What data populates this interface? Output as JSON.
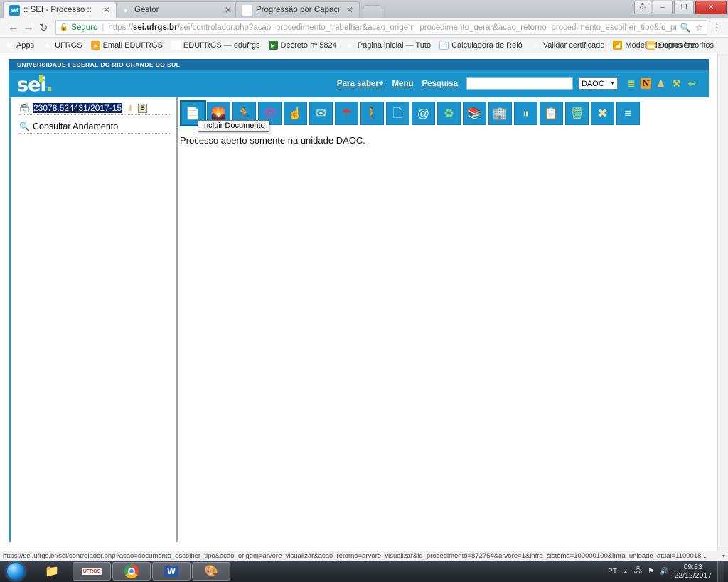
{
  "window": {
    "controls": {
      "user": "user-icon",
      "minimize": "–",
      "maximize": "❐",
      "close": "✕"
    }
  },
  "tabs": [
    {
      "title": ":: SEI - Processo ::",
      "favicon": "sei-favicon",
      "favicon_text": "sei",
      "active": true,
      "close": "✕"
    },
    {
      "title": "Gestor",
      "favicon": "ufrgs-favicon",
      "favicon_text": "♣",
      "active": false,
      "close": "✕"
    },
    {
      "title": "Progressão por Capacita",
      "favicon": "edufrgs-favicon",
      "favicon_text": "⊙",
      "active": false,
      "close": "✕"
    }
  ],
  "toolbar": {
    "back_icon": "back-arrow-icon",
    "forward_icon": "forward-arrow-icon",
    "reload_icon": "reload-icon",
    "secure_label": "Seguro",
    "url_prefix": "https://",
    "url_domain": "sei.ufrgs.br",
    "url_rest": "/sei/controlador.php?acao=procedimento_trabalhar&acao_origem=procedimento_gerar&acao_retorno=procedimento_escolher_tipo&id_proce...",
    "zoom_icon": "magnifier-icon",
    "star_icon": "star-icon",
    "menu_icon": "chrome-menu-icon"
  },
  "bookmarks": {
    "apps_label": "Apps",
    "items": [
      {
        "label": "UFRGS",
        "icon": "ufrgs-icon"
      },
      {
        "label": "Email EDUFRGS",
        "icon": "mail-icon"
      },
      {
        "label": "EDUFRGS — edufrgs",
        "icon": "edufrgs-icon"
      },
      {
        "label": "Decreto nº 5824",
        "icon": "decree-icon"
      },
      {
        "label": "Página inicial — Tuto",
        "icon": "ufrgs-icon"
      },
      {
        "label": "Calculadora de Reló",
        "icon": "document-icon"
      },
      {
        "label": "Validar certificado",
        "icon": "certificate-icon"
      },
      {
        "label": "Modelo de apresent",
        "icon": "presentation-icon"
      }
    ],
    "other_label": "Outros favoritos",
    "other_icon": "folder-icon"
  },
  "sei": {
    "institution": "UNIVERSIDADE FEDERAL DO RIO GRANDE DO SUL",
    "logo": "sei",
    "nav": {
      "saber_mais": "Para saber+",
      "menu": "Menu",
      "pesquisa": "Pesquisa",
      "search_value": "",
      "search_placeholder": "",
      "unit_selected": "DAOC",
      "caret": "▼",
      "icons": [
        {
          "name": "menu-list-icon",
          "glyph": "≣"
        },
        {
          "name": "novidades-icon",
          "glyph": "N"
        },
        {
          "name": "user-icon",
          "glyph": "♟"
        },
        {
          "name": "wrench-icon",
          "glyph": "⚒"
        },
        {
          "name": "logout-icon",
          "glyph": "↩"
        }
      ]
    },
    "tree": {
      "process_number": "23078.524431/2017-15",
      "process_icon": "process-document-icon",
      "badges": [
        {
          "name": "key-icon",
          "glyph": "⚷"
        },
        {
          "name": "b-badge-icon",
          "glyph": "B"
        }
      ],
      "consult_label": "Consultar Andamento",
      "consult_icon": "magnifier-icon"
    },
    "action_buttons": [
      {
        "name": "incluir-documento-button",
        "glyph": "📄",
        "selected": true
      },
      {
        "name": "atualizar-andamento-button",
        "glyph": "🖼"
      },
      {
        "name": "atribuir-processo-button",
        "glyph": "🏃"
      },
      {
        "name": "acompanhamento-especial-button",
        "glyph": "👁"
      },
      {
        "name": "anotacoes-button",
        "glyph": "☝"
      },
      {
        "name": "enviar-correspondencia-eletronica-button",
        "glyph": "✉"
      },
      {
        "name": "ciencia-button",
        "glyph": "☂"
      },
      {
        "name": "consultar-alterar-processo-button",
        "glyph": "🚶"
      },
      {
        "name": "duplicar-processo-button",
        "glyph": "↻"
      },
      {
        "name": "enviar-email-button",
        "glyph": "@"
      },
      {
        "name": "atualizar-andamento2-button",
        "glyph": "♻"
      },
      {
        "name": "gerar-arquivo-button",
        "glyph": "📚"
      },
      {
        "name": "bloquear-processo-button",
        "glyph": "🏢"
      },
      {
        "name": "sobrestar-processo-button",
        "glyph": "⏸"
      },
      {
        "name": "anotacoes2-button",
        "glyph": "📋"
      },
      {
        "name": "reabrir-processo-button",
        "glyph": "🗑"
      },
      {
        "name": "excluir-processo-button",
        "glyph": "✖"
      },
      {
        "name": "consultar-andamento-button",
        "glyph": "≡"
      }
    ],
    "tooltip": "Incluir Documento",
    "content_message": "Processo aberto somente na unidade DAOC."
  },
  "status_bar": {
    "url": "https://sei.ufrgs.br/sei/controlador.php?acao=documento_escolher_tipo&acao_origem=arvore_visualizar&acao_retorno=arvore_visualizar&id_procedimento=872754&arvore=1&infra_sistema=100000100&infra_unidade_atual=1100018...",
    "dropdown_icon": "▾"
  },
  "taskbar": {
    "start_icon": "windows-start-orb",
    "items": [
      {
        "name": "file-explorer-taskbar-item",
        "glyph": "📁",
        "active": false,
        "framed": false
      },
      {
        "name": "ufrgs-app-taskbar-item",
        "glyph": "UFRGS",
        "active": true,
        "framed": true
      },
      {
        "name": "chrome-taskbar-item",
        "glyph": "chrome",
        "active": true,
        "framed": true
      },
      {
        "name": "word-taskbar-item",
        "glyph": "W",
        "active": true,
        "framed": true
      },
      {
        "name": "paint-taskbar-item",
        "glyph": "🎨",
        "active": true,
        "framed": true
      }
    ],
    "tray": {
      "language": "PT",
      "show_hidden_icon": "▲",
      "network_icon": "🖧",
      "flag_icon": "⚑",
      "volume_icon": "🔊",
      "time": "09:33",
      "date": "22/12/2017"
    }
  }
}
